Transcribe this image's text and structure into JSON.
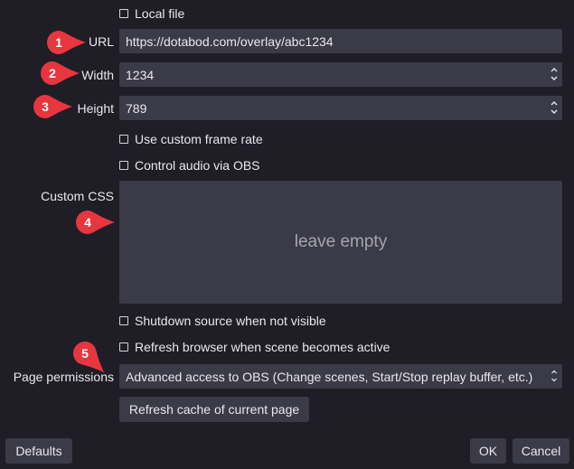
{
  "checkboxes": {
    "local_file": "Local file",
    "custom_frame_rate": "Use custom frame rate",
    "control_audio": "Control audio via OBS",
    "shutdown_source": "Shutdown source when not visible",
    "refresh_browser": "Refresh browser when scene becomes active"
  },
  "fields": {
    "url": {
      "label": "URL",
      "value": "https://dotabod.com/overlay/abc1234"
    },
    "width": {
      "label": "Width",
      "value": "1234"
    },
    "height": {
      "label": "Height",
      "value": "789"
    },
    "custom_css": {
      "label": "Custom CSS",
      "placeholder": "leave empty"
    },
    "page_permissions": {
      "label": "Page permissions",
      "value": "Advanced access to OBS (Change scenes, Start/Stop replay buffer, etc.)"
    }
  },
  "buttons": {
    "refresh_cache": "Refresh cache of current page",
    "defaults": "Defaults",
    "ok": "OK",
    "cancel": "Cancel"
  },
  "markers": [
    "1",
    "2",
    "3",
    "4",
    "5"
  ],
  "colors": {
    "background": "#1f1e27",
    "field": "#3b3a47",
    "marker": "#e8363f",
    "text": "#e8e8ec",
    "placeholder": "#a5a5ae"
  }
}
